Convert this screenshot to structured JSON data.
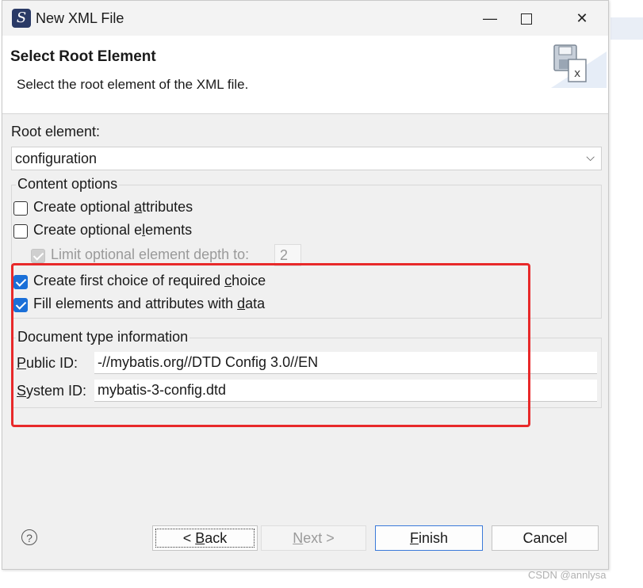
{
  "window": {
    "title": "New XML File",
    "app_icon_glyph": "S",
    "min_glyph": "—",
    "close_glyph": "✕"
  },
  "header": {
    "title": "Select Root Element",
    "description": "Select the root element of the XML file."
  },
  "root_element": {
    "label": "Root element:",
    "value": "configuration",
    "arrow_glyph": "⌵"
  },
  "content_options": {
    "title": "Content options",
    "items": [
      {
        "pre": "Create optional ",
        "mnemonic": "a",
        "post": "ttributes",
        "checked": false,
        "enabled": true
      },
      {
        "pre": "Create optional e",
        "mnemonic": "l",
        "post": "ements",
        "checked": false,
        "enabled": true
      },
      {
        "pre": "Limit optional element depth to:",
        "mnemonic": "",
        "post": "",
        "checked": true,
        "enabled": false
      },
      {
        "pre": "Create first choice of required ",
        "mnemonic": "c",
        "post": "hoice",
        "checked": true,
        "enabled": true
      },
      {
        "pre": "Fill elements and attributes with ",
        "mnemonic": "d",
        "post": "ata",
        "checked": true,
        "enabled": true
      }
    ],
    "depth_value": "2"
  },
  "doctype": {
    "title": "Document type information",
    "public_label_mn": "P",
    "public_label_rest": "ublic ID:",
    "public_value": "-//mybatis.org//DTD Config 3.0//EN",
    "system_label_mn": "S",
    "system_label_rest": "ystem ID:",
    "system_value": "mybatis-3-config.dtd"
  },
  "buttons": {
    "help": "?",
    "back_pre": "< ",
    "back_mn": "B",
    "back_post": "ack",
    "next_mn": "N",
    "next_post": "ext >",
    "finish_mn": "F",
    "finish_post": "inish",
    "cancel": "Cancel"
  },
  "watermark": "CSDN @annlysa",
  "colors": {
    "checkbox_checked": "#1a6fd8",
    "annotation_red": "#e8292a",
    "finish_border": "#3b7ad9"
  },
  "icons": [
    "app-logo-icon",
    "minimize-icon",
    "maximize-icon",
    "close-icon",
    "xml-wizard-icon",
    "dropdown-arrow-icon",
    "help-icon",
    "checkmark-icon"
  ]
}
